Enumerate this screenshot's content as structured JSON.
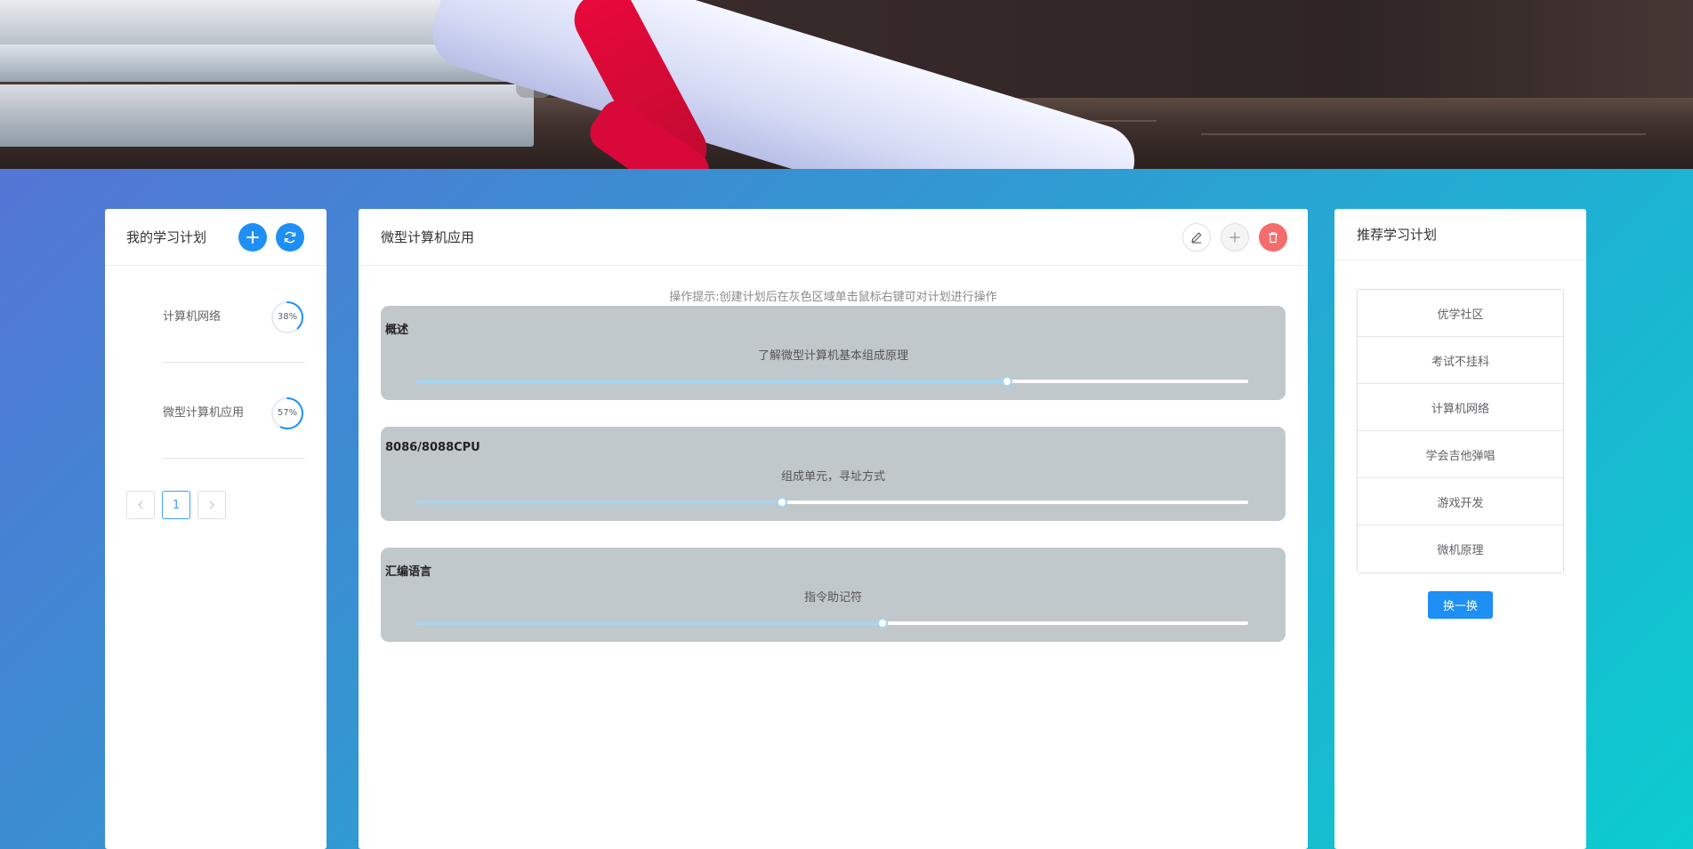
{
  "my_plans": {
    "title": "我的学习计划",
    "add_icon": "plus-icon",
    "refresh_icon": "refresh-icon",
    "items": [
      {
        "name": "计算机网络",
        "progress_label": "38%",
        "progress": 0.38
      },
      {
        "name": "微型计算机应用",
        "progress_label": "57%",
        "progress": 0.57
      }
    ],
    "pagination": {
      "prev": "<",
      "current_page": "1",
      "next": ">"
    }
  },
  "plan_detail": {
    "title": "微型计算机应用",
    "edit_icon": "edit-pencil-icon",
    "add_icon": "plus-icon",
    "delete_icon": "trash-icon",
    "tip": "操作提示:创建计划后在灰色区域单击鼠标右键可对计划进行操作",
    "sections": [
      {
        "title": "概述",
        "description": "了解微型计算机基本组成原理",
        "progress": 0.71
      },
      {
        "title": "8086/8088CPU",
        "description": "组成单元，寻址方式",
        "progress": 0.44
      },
      {
        "title": "汇编语言",
        "description": "指令助记符",
        "progress": 0.56
      }
    ]
  },
  "recommend": {
    "title": "推荐学习计划",
    "items": [
      "优学社区",
      "考试不挂科",
      "计算机网络",
      "学会吉他弹唱",
      "游戏开发",
      "微机原理"
    ],
    "swap_label": "换一换"
  },
  "colors": {
    "primary": "#1e8ff5",
    "danger": "#f56c6c",
    "section_bg": "#c0c8cb",
    "slider_fill": "#a8d4ef"
  }
}
